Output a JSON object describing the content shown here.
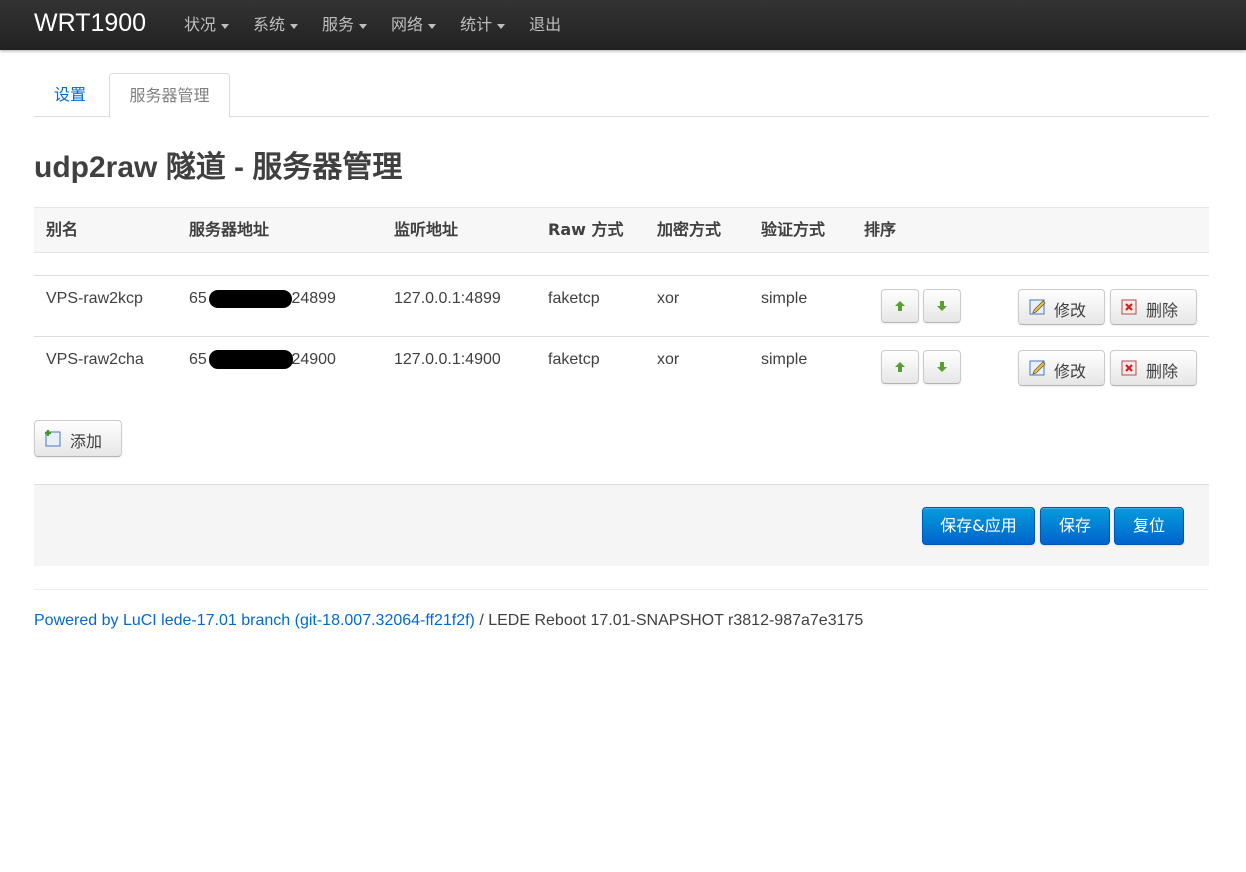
{
  "navbar": {
    "brand": "WRT1900",
    "menu": [
      {
        "label": "状况",
        "dropdown": true
      },
      {
        "label": "系统",
        "dropdown": true
      },
      {
        "label": "服务",
        "dropdown": true
      },
      {
        "label": "网络",
        "dropdown": true
      },
      {
        "label": "统计",
        "dropdown": true
      },
      {
        "label": "退出",
        "dropdown": false
      }
    ]
  },
  "tabs": [
    {
      "label": "设置",
      "active": false
    },
    {
      "label": "服务器管理",
      "active": true
    }
  ],
  "page_title": "udp2raw 隧道 - 服务器管理",
  "table": {
    "headers": [
      "别名",
      "服务器地址",
      "监听地址",
      "Raw 方式",
      "加密方式",
      "验证方式",
      "排序"
    ],
    "rows": [
      {
        "alias": "VPS-raw2kcp",
        "server_prefix": "65",
        "server_suffix": ":24899",
        "listen": "127.0.0.1:4899",
        "raw_mode": "faketcp",
        "cipher": "xor",
        "auth": "simple"
      },
      {
        "alias": "VPS-raw2cha",
        "server_prefix": "65",
        "server_suffix": ":24900",
        "listen": "127.0.0.1:4900",
        "raw_mode": "faketcp",
        "cipher": "xor",
        "auth": "simple"
      }
    ],
    "edit_label": "修改",
    "delete_label": "删除"
  },
  "add_label": "添加",
  "actions": {
    "save_apply": "保存&应用",
    "save": "保存",
    "reset": "复位"
  },
  "footer": {
    "link_text": "Powered by LuCI lede-17.01 branch (git-18.007.32064-ff21f2f)",
    "rest": " / LEDE Reboot 17.01-SNAPSHOT r3812-987a7e3175"
  },
  "colors": {
    "navbar": "#222222",
    "link": "#0069d6",
    "primary_button": "#0064cd",
    "arrow_icon": "#5a9e32"
  }
}
